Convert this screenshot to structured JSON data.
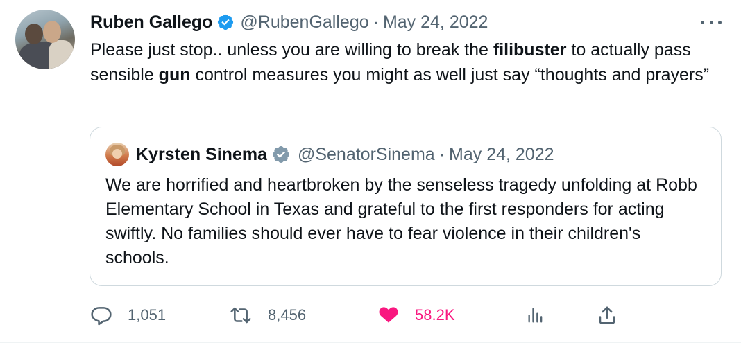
{
  "author": {
    "name": "Ruben Gallego",
    "handle": "@RubenGallego",
    "separator": "·",
    "date": "May 24, 2022"
  },
  "tweet": {
    "text_part1": "Please just stop.. unless you are willing to break the ",
    "bold1": "filibuster",
    "text_part2": " to actually pass sensible ",
    "bold2": "gun",
    "text_part3": " control measures you might as well just say “thoughts and prayers”"
  },
  "quoted": {
    "name": "Kyrsten Sinema",
    "handle": "@SenatorSinema",
    "separator": "·",
    "date": "May 24, 2022",
    "text": "We are horrified and heartbroken by the senseless tragedy unfolding at Robb Elementary School in Texas and grateful to the first responders for acting swiftly. No families should ever have to fear violence in their children's schools."
  },
  "actions": {
    "replies": "1,051",
    "retweets": "8,456",
    "likes": "58.2K"
  },
  "icons": {
    "verified": "verified-badge-icon",
    "more": "more-icon",
    "reply": "reply-icon",
    "retweet": "retweet-icon",
    "like": "heart-icon",
    "views": "views-icon",
    "share": "share-icon"
  },
  "colors": {
    "verified": "#1d9bf0",
    "quote_verified": "#829aab",
    "like": "#f91880",
    "muted": "#536471"
  }
}
